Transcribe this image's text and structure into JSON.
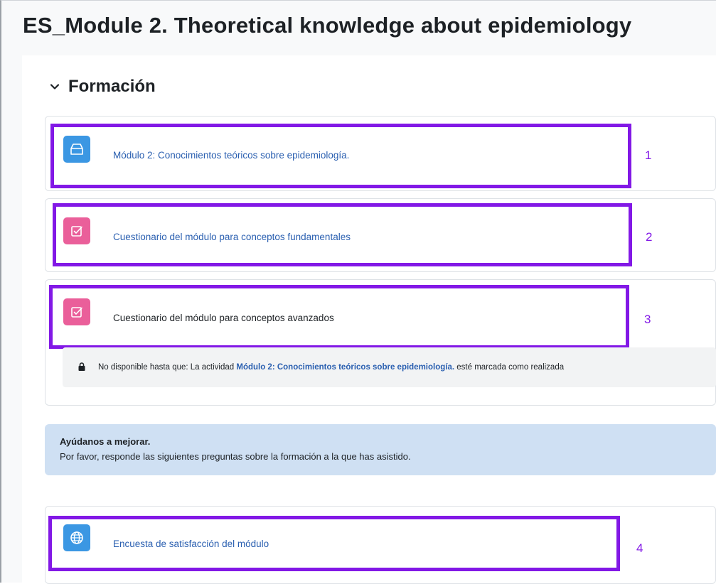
{
  "page_title": "ES_Module 2. Theoretical knowledge about epidemiology",
  "section": {
    "title": "Formación",
    "icon": "chevron-down-icon"
  },
  "activities": [
    {
      "label": "Módulo 2: Conocimientos teóricos sobre epidemiología.",
      "icon": "book-icon",
      "icon_color": "#3b97e3",
      "marker": "1",
      "available": true
    },
    {
      "label": "Cuestionario del módulo para conceptos fundamentales",
      "icon": "quiz-check-icon",
      "icon_color": "#ea5f9a",
      "marker": "2",
      "available": true
    },
    {
      "label": "Cuestionario del módulo para conceptos avanzados",
      "icon": "quiz-check-icon",
      "icon_color": "#ea5f9a",
      "marker": "3",
      "available": false
    },
    {
      "label": "Encuesta de satisfacción del módulo",
      "icon": "globe-icon",
      "icon_color": "#3b97e3",
      "marker": "4",
      "available": true
    }
  ],
  "restriction": {
    "prefix": "No disponible hasta que: La actividad ",
    "link": "Módulo 2: Conocimientos teóricos sobre epidemiología.",
    "suffix": " esté marcada como realizada",
    "icon": "lock-icon"
  },
  "notice": {
    "heading": "Ayúdanos a mejorar.",
    "text": "Por favor, responde las siguientes preguntas sobre la formación a la que has asistido."
  },
  "colors": {
    "highlight": "#8218e6",
    "link": "#2a5fb0",
    "notice_bg": "#cfe0f3"
  }
}
